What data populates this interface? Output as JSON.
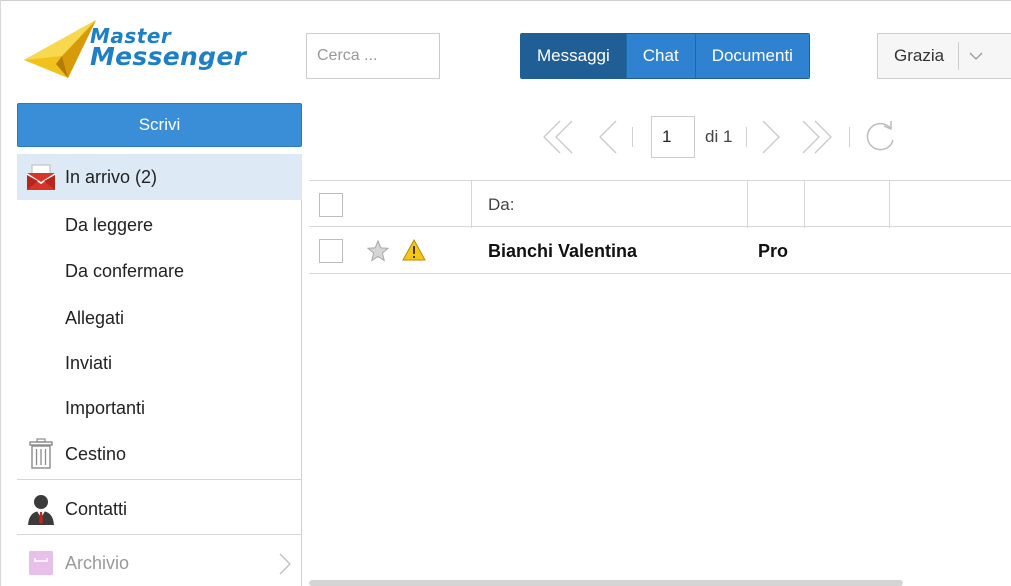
{
  "app": {
    "logo_line1": "Master",
    "logo_line2": "Messenger"
  },
  "search": {
    "placeholder": "Cerca ..."
  },
  "nav_tabs": [
    {
      "label": "Messaggi",
      "active": true
    },
    {
      "label": "Chat",
      "active": false
    },
    {
      "label": "Documenti",
      "active": false
    }
  ],
  "user": {
    "name": "Grazia"
  },
  "compose": {
    "label": "Scrivi"
  },
  "sidebar": {
    "items": [
      {
        "label": "In arrivo (2)",
        "icon": "envelope-icon"
      },
      {
        "label": "Da leggere"
      },
      {
        "label": "Da confermare"
      },
      {
        "label": "Allegati"
      },
      {
        "label": "Inviati"
      },
      {
        "label": "Importanti"
      },
      {
        "label": "Cestino",
        "icon": "trash-icon"
      },
      {
        "label": "Contatti",
        "icon": "person-icon"
      },
      {
        "label": "Archivio",
        "icon": "archive-icon"
      }
    ]
  },
  "pager": {
    "current_page": "1",
    "total_label": "di 1"
  },
  "table": {
    "header_from": "Da:",
    "rows": [
      {
        "sender": "Bianchi Valentina",
        "subject": "Pro"
      }
    ]
  },
  "colors": {
    "accent": "#2f82cf",
    "active_tab": "#1f5f96",
    "compose": "#3a8ed8",
    "active_item": "#dde9f4"
  }
}
